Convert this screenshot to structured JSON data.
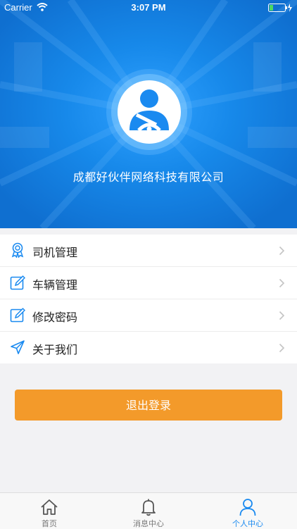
{
  "status_bar": {
    "carrier": "Carrier",
    "time": "3:07 PM"
  },
  "profile": {
    "avatar_icon": "driver-avatar-icon",
    "company_name": "成都好伙伴网络科技有限公司"
  },
  "menu": {
    "items": [
      {
        "label": "司机管理",
        "icon": "award-icon"
      },
      {
        "label": "车辆管理",
        "icon": "edit-icon"
      },
      {
        "label": "修改密码",
        "icon": "edit-icon"
      },
      {
        "label": "关于我们",
        "icon": "send-icon"
      }
    ]
  },
  "logout": {
    "label": "退出登录"
  },
  "tabbar": {
    "tabs": [
      {
        "label": "首页",
        "icon": "home-icon"
      },
      {
        "label": "消息中心",
        "icon": "bell-icon"
      },
      {
        "label": "个人中心",
        "icon": "person-icon"
      }
    ]
  },
  "colors": {
    "header_blue": "#1789ea",
    "accent_blue": "#1a8af0",
    "logout_orange": "#f39a2a"
  }
}
